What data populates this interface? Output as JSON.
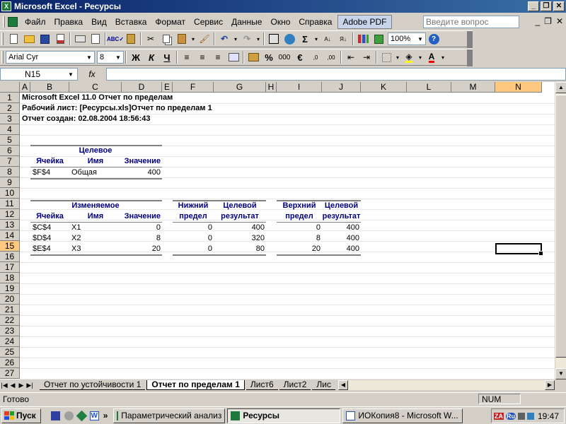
{
  "window": {
    "title": "Microsoft Excel - Ресурсы",
    "icon": "excel-icon"
  },
  "menu": {
    "items": [
      "Файл",
      "Правка",
      "Вид",
      "Вставка",
      "Формат",
      "Сервис",
      "Данные",
      "Окно",
      "Справка",
      "Adobe PDF"
    ],
    "help_placeholder": "Введите вопрос"
  },
  "toolbar": {
    "zoom": "100%",
    "font_name": "Arial Cyr",
    "font_size": "8",
    "bold": "Ж",
    "italic": "К",
    "underline": "Ч",
    "sum": "Σ",
    "percent": "%",
    "thousands": "000",
    "euro": "€",
    "text_color_letter": "A"
  },
  "formula": {
    "cell_ref": "N15",
    "fx": "fx",
    "value": ""
  },
  "columns": [
    "A",
    "B",
    "C",
    "D",
    "E",
    "F",
    "G",
    "H",
    "I",
    "J",
    "K",
    "L",
    "M",
    "N"
  ],
  "rows": [
    "1",
    "2",
    "3",
    "4",
    "5",
    "6",
    "7",
    "8",
    "9",
    "10",
    "11",
    "12",
    "13",
    "14",
    "15",
    "16",
    "17",
    "18",
    "19",
    "20",
    "21",
    "22",
    "23",
    "24",
    "25",
    "26",
    "27"
  ],
  "report": {
    "line1": "Microsoft Excel 11.0 Отчет по пределам",
    "line2": "Рабочий лист: [Ресурсы.xls]Отчет по пределам 1",
    "line3": "Отчет создан: 02.08.2004 18:56:43",
    "target": {
      "header": "Целевое",
      "col_cell": "Ячейка",
      "col_name": "Имя",
      "col_value": "Значение",
      "row": {
        "cell": "$F$4",
        "name": "Общая",
        "value": "400"
      }
    },
    "variable": {
      "header": "Изменяемое",
      "col_cell": "Ячейка",
      "col_name": "Имя",
      "col_value": "Значение",
      "lower_top": "Нижний",
      "lower_bottom": "предел",
      "result_top": "Целевой",
      "result_bottom": "результат",
      "upper_top": "Верхний",
      "upper_bottom": "предел",
      "result2_top": "Целевой",
      "result2_bottom": "результат",
      "rows": [
        {
          "cell": "$C$4",
          "name": "X1",
          "value": "0",
          "lower": "0",
          "lower_result": "400",
          "upper": "0",
          "upper_result": "400"
        },
        {
          "cell": "$D$4",
          "name": "X2",
          "value": "8",
          "lower": "0",
          "lower_result": "320",
          "upper": "8",
          "upper_result": "400"
        },
        {
          "cell": "$E$4",
          "name": "X3",
          "value": "20",
          "lower": "0",
          "lower_result": "80",
          "upper": "20",
          "upper_result": "400"
        }
      ]
    }
  },
  "sheets": {
    "tabs": [
      "Отчет по устойчивости 1",
      "Отчет по пределам 1",
      "Лист6",
      "Лист2",
      "Лис"
    ],
    "active": "Отчет по пределам 1"
  },
  "status": {
    "ready": "Готово",
    "num": "NUM"
  },
  "taskbar": {
    "start": "Пуск",
    "quick_launch_more": "»",
    "tasks": [
      "Параметрический анализ",
      "Ресурсы",
      "ИОКопия8 - Microsoft W..."
    ],
    "active_task": "Ресурсы",
    "tray": {
      "za": "ZA",
      "lang": "Ru",
      "time": "19:47"
    }
  }
}
